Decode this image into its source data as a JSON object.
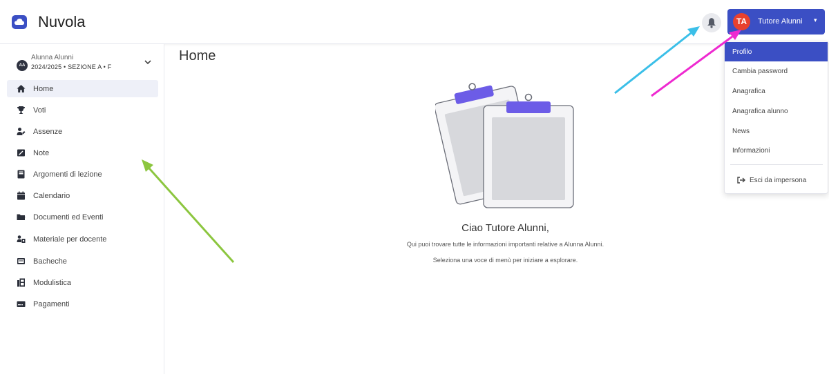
{
  "app": {
    "title": "Nuvola"
  },
  "user": {
    "initials": "TA",
    "name": "Tutore Alunni",
    "caret": "▾"
  },
  "student": {
    "initials": "AA",
    "name": "Alunna Alunni",
    "class_info": "2024/2025 • SEZIONE A • F"
  },
  "nav": [
    {
      "label": "Home",
      "icon": "home-icon",
      "active": true
    },
    {
      "label": "Voti",
      "icon": "trophy-icon",
      "active": false
    },
    {
      "label": "Assenze",
      "icon": "user-absence-icon",
      "active": false
    },
    {
      "label": "Note",
      "icon": "note-icon",
      "active": false
    },
    {
      "label": "Argomenti di lezione",
      "icon": "book-icon",
      "active": false
    },
    {
      "label": "Calendario",
      "icon": "calendar-icon",
      "active": false
    },
    {
      "label": "Documenti ed Eventi",
      "icon": "folder-icon",
      "active": false
    },
    {
      "label": "Materiale per docente",
      "icon": "material-icon",
      "active": false
    },
    {
      "label": "Bacheche",
      "icon": "board-icon",
      "active": false
    },
    {
      "label": "Modulistica",
      "icon": "forms-icon",
      "active": false
    },
    {
      "label": "Pagamenti",
      "icon": "payment-icon",
      "active": false
    }
  ],
  "main": {
    "title": "Home",
    "greeting": "Ciao Tutore Alunni,",
    "line1": "Qui puoi trovare tutte le informazioni importanti relative a Alunna Alunni.",
    "line2": "Seleziona una voce di menù per iniziare a esplorare."
  },
  "dropdown": {
    "items": [
      "Profilo",
      "Cambia password",
      "Anagrafica",
      "Anagrafica alunno",
      "News",
      "Informazioni"
    ],
    "active_index": 0,
    "exit_label": "Esci da impersona"
  },
  "colors": {
    "brand": "#3b4fc4",
    "avatar": "#e8412f",
    "arrow_blue": "#3bbfe8",
    "arrow_magenta": "#ee2ad0",
    "arrow_green": "#8cc63f"
  }
}
